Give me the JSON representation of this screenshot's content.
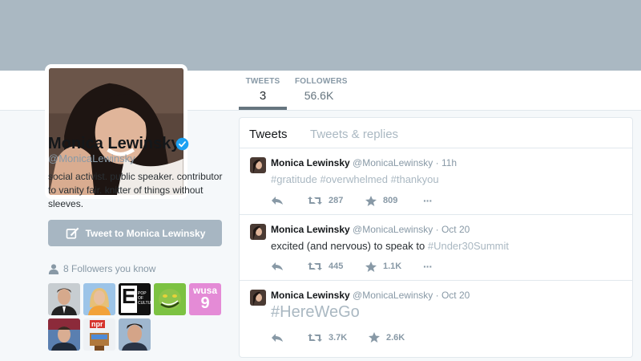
{
  "profile": {
    "name": "Monica Lewinsky",
    "handle": "@MonicaLewinsky",
    "bio": "social activist. public speaker. contributor to vanity fair. knitter of things without sleeves.",
    "tweet_to_label": "Tweet to Monica Lewinsky",
    "followers_you_know": "8 Followers you know"
  },
  "stats": {
    "tweets_label": "TWEETS",
    "tweets_value": "3",
    "followers_label": "FOLLOWERS",
    "followers_value": "56.6K"
  },
  "tabs": [
    "Tweets",
    "Tweets & replies"
  ],
  "tweets": [
    {
      "name": "Monica Lewinsky",
      "handle": "@MonicaLewinsky",
      "sep": "·",
      "time": "11h",
      "text_parts": [
        "#gratitude",
        " ",
        "#overwhelmed",
        " ",
        "#thankyou"
      ],
      "retweets": "287",
      "likes": "809"
    },
    {
      "name": "Monica Lewinsky",
      "handle": "@MonicaLewinsky",
      "sep": "·",
      "time": "Oct 20",
      "text_parts": [
        "excited (and nervous) to speak to ",
        "#Under30Summit"
      ],
      "retweets": "445",
      "likes": "1.1K"
    },
    {
      "name": "Monica Lewinsky",
      "handle": "@MonicaLewinsky",
      "sep": "·",
      "time": "Oct 20",
      "text_parts": [
        "#HereWeGo"
      ],
      "retweets": "3.7K",
      "likes": "2.6K"
    }
  ],
  "follower_badges": {
    "e_letter": "E",
    "e_caption": "POP OF CULTURE",
    "wusa_text": "wusa",
    "wusa_nine": "9",
    "npr_text": "npr"
  },
  "more_icon": "···",
  "colors": {
    "banner": "#aab8c2",
    "verified": "#1da1f2",
    "hashtag": "#aab8c2",
    "button": "#a7b6c2"
  },
  "icons": [
    "verified-badge-icon",
    "compose-icon",
    "person-icon",
    "reply-icon",
    "retweet-icon",
    "star-icon",
    "more-icon"
  ]
}
